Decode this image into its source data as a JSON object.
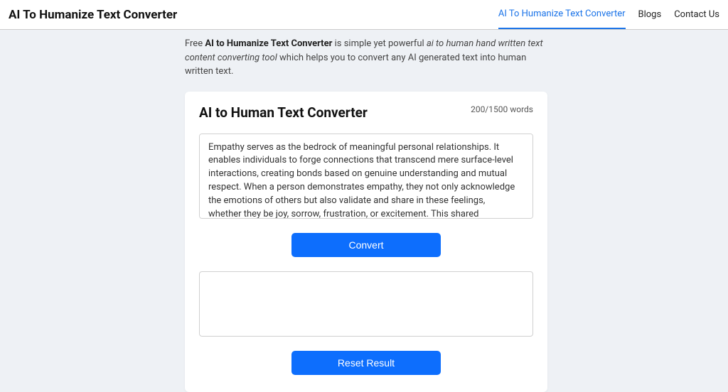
{
  "header": {
    "title": "AI To Humanize Text Converter",
    "nav": {
      "converter": "AI To Humanize Text Converter",
      "blogs": "Blogs",
      "contact": "Contact Us"
    }
  },
  "intro": {
    "prefix": "Free ",
    "bold": "AI to Humanize Text Converter",
    "mid1": " is simple yet powerful ",
    "italic": "ai to human hand written text content converting tool",
    "suffix": " which helps you to convert any AI generated text into human written text."
  },
  "card": {
    "title": "AI to Human Text Converter",
    "word_count": "200/1500 words",
    "input_text": "Empathy serves as the bedrock of meaningful personal relationships. It enables individuals to forge connections that transcend mere surface-level interactions, creating bonds based on genuine understanding and mutual respect. When a person demonstrates empathy, they not only acknowledge the emotions of others but also validate and share in these feelings, whether they be joy, sorrow, frustration, or excitement. This shared emotional experience can significantly deepen the connection between individuals, fostering a sense of trust and",
    "convert_label": "Convert",
    "reset_label": "Reset Result"
  }
}
